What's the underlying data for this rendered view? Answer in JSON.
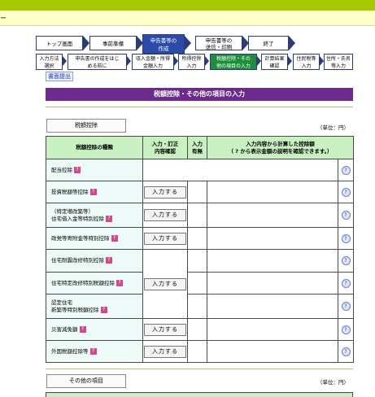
{
  "header": {
    "title": "ー"
  },
  "steps": [
    {
      "label": "トップ画面"
    },
    {
      "label": "事前準備"
    },
    {
      "label": "申告書等の\n作成"
    },
    {
      "label": "申告書等の\n送信・印刷"
    },
    {
      "label": "終了"
    }
  ],
  "substeps": [
    {
      "label": "入力方法\n選択"
    },
    {
      "label": "申告書の作成をはじ\nめる前に"
    },
    {
      "label": "収入金額・所得\n金額入力"
    },
    {
      "label": "所得控除\n入力"
    },
    {
      "label": "税額控除・その\n他の項目の入力"
    },
    {
      "label": "計算結果\n確認"
    },
    {
      "label": "住民税等\n入力"
    },
    {
      "label": "住所・氏名\n等入力"
    }
  ],
  "print_link": "書面提出",
  "section_title": "税額控除・その他の項目の入力",
  "tax_tab": "税額控除",
  "other_tab": "その他の項目",
  "unit": "（単位：円）",
  "table": {
    "headers": {
      "name": "税額控除の種類",
      "input": "入力・訂正\n内容確認",
      "done": "入力\n有無",
      "amount": "入力内容から計算した控除額\n（ ? から表示金額の説明を確認できます。）"
    },
    "button_label": "入力する",
    "rows": [
      {
        "name": "配当控除"
      },
      {
        "name": "投資税額等控除"
      },
      {
        "name": "（特定増改築等）\n住宅借入金等特別控除"
      },
      {
        "name": "政党等寄附金等特別控除"
      },
      {
        "name": "住宅耐震改修特別控除"
      },
      {
        "name": "住宅特定改修特別税額控除"
      },
      {
        "name": "認定住宅\n新築等特別税額控除"
      },
      {
        "name": "災害減免額"
      },
      {
        "name": "外国税額控除等"
      }
    ]
  }
}
